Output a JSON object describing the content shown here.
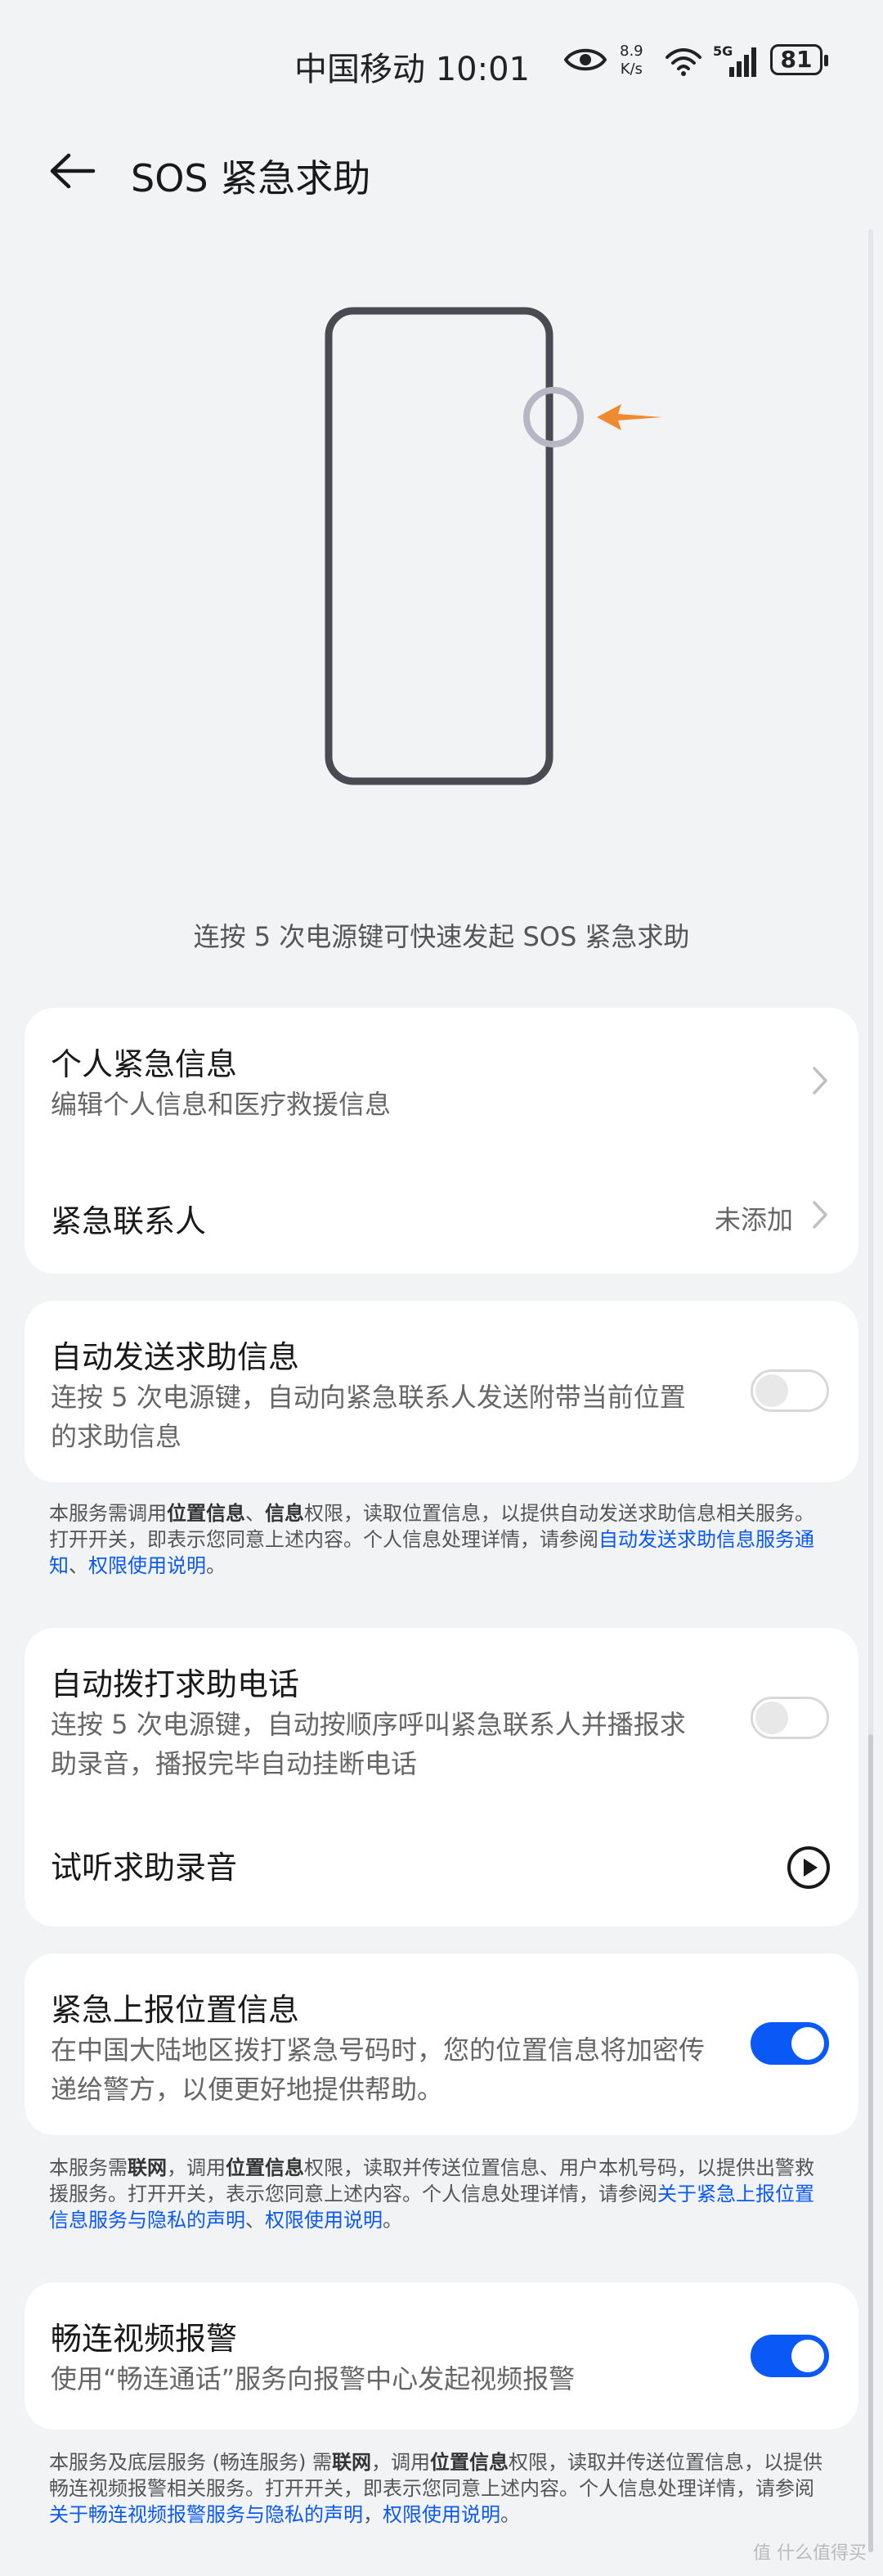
{
  "status_bar": {
    "carrier": "中国移动 10:01",
    "speed_value": "8.9",
    "speed_unit": "K/s",
    "network": "5G",
    "battery": "81"
  },
  "header": {
    "title": "SOS 紧急求助"
  },
  "illustration": {
    "caption": "连按 5 次电源键可快速发起 SOS 紧急求助"
  },
  "card_personal": {
    "info_title": "个人紧急信息",
    "info_sub": "编辑个人信息和医疗救援信息",
    "contacts_title": "紧急联系人",
    "contacts_value": "未添加"
  },
  "card_auto_send": {
    "title": "自动发送求助信息",
    "sub": "连按 5 次电源键，自动向紧急联系人发送附带当前位置的求助信息",
    "toggle_on": false
  },
  "note_auto_send": {
    "t1": "本服务需调用",
    "b1": "位置信息",
    "t2": "、",
    "b2": "信息",
    "t3": "权限，读取位置信息，以提供自动发送求助信息相关服务。打开开关，即表示您同意上述内容。个人信息处理详情，请参阅",
    "l1": "自动发送求助信息服务通知",
    "t4": "、",
    "l2": "权限使用说明",
    "t5": "。"
  },
  "card_auto_call": {
    "title": "自动拨打求助电话",
    "sub": "连按 5 次电源键，自动按顺序呼叫紧急联系人并播报求助录音，播报完毕自动挂断电话",
    "toggle_on": false,
    "preview_label": "试听求助录音"
  },
  "card_location": {
    "title": "紧急上报位置信息",
    "sub": "在中国大陆地区拨打紧急号码时，您的位置信息将加密传递给警方，以便更好地提供帮助。",
    "toggle_on": true
  },
  "note_location": {
    "t1": "本服务需",
    "b1": "联网",
    "t2": "，调用",
    "b2": "位置信息",
    "t3": "权限，读取并传送位置信息、用户本机号码，以提供出警救援服务。打开开关，表示您同意上述内容。个人信息处理详情，请参阅",
    "l1": "关于紧急上报位置信息服务与隐私的声明",
    "t4": "、",
    "l2": "权限使用说明",
    "t5": "。"
  },
  "card_video": {
    "title": "畅连视频报警",
    "sub": "使用“畅连通话”服务向报警中心发起视频报警",
    "toggle_on": true
  },
  "note_video": {
    "t1": "本服务及底层服务 (畅连服务) 需",
    "b1": "联网",
    "t2": "，调用",
    "b2": "位置信息",
    "t3": "权限，读取并传送位置信息，以提供畅连视频报警相关服务。打开开关，即表示您同意上述内容。个人信息处理详情，请参阅",
    "l1": "关于畅连视频报警服务与隐私的声明",
    "t4": "，",
    "l2": "权限使用说明",
    "t5": "。"
  },
  "watermark": "值 什么值得买",
  "colors": {
    "accent": "#0a59f7",
    "background": "#f1f3f5",
    "arrow": "#f08a30"
  }
}
